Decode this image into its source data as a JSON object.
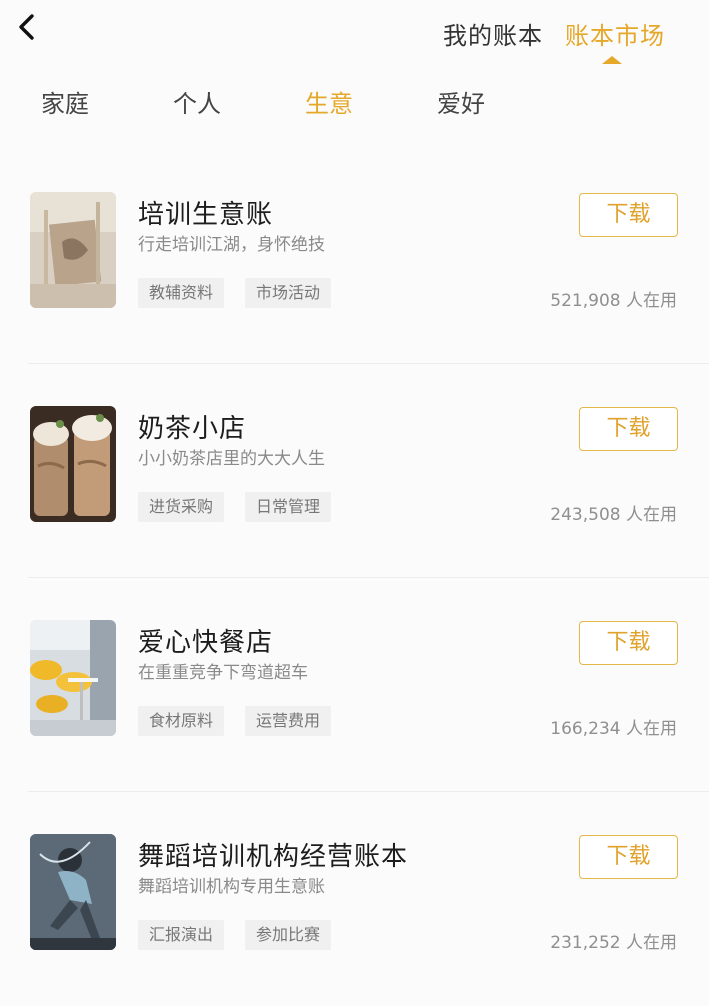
{
  "header": {
    "tabs": [
      {
        "label": "我的账本"
      },
      {
        "label": "账本市场"
      }
    ]
  },
  "categories": [
    "家庭",
    "个人",
    "生意",
    "爱好"
  ],
  "colors": {
    "accent": "#e5a82a"
  },
  "items": [
    {
      "title": "培训生意账",
      "subtitle": "行走培训江湖，身怀绝技",
      "tags": [
        "教辅资料",
        "市场活动"
      ],
      "button": "下载",
      "usage": "521,908 人在用"
    },
    {
      "title": "奶茶小店",
      "subtitle": "小小奶茶店里的大大人生",
      "tags": [
        "进货采购",
        "日常管理"
      ],
      "button": "下载",
      "usage": "243,508 人在用"
    },
    {
      "title": "爱心快餐店",
      "subtitle": "在重重竞争下弯道超车",
      "tags": [
        "食材原料",
        "运营费用"
      ],
      "button": "下载",
      "usage": "166,234 人在用"
    },
    {
      "title": "舞蹈培训机构经营账本",
      "subtitle": "舞蹈培训机构专用生意账",
      "tags": [
        "汇报演出",
        "参加比赛"
      ],
      "button": "下载",
      "usage": "231,252 人在用"
    }
  ]
}
